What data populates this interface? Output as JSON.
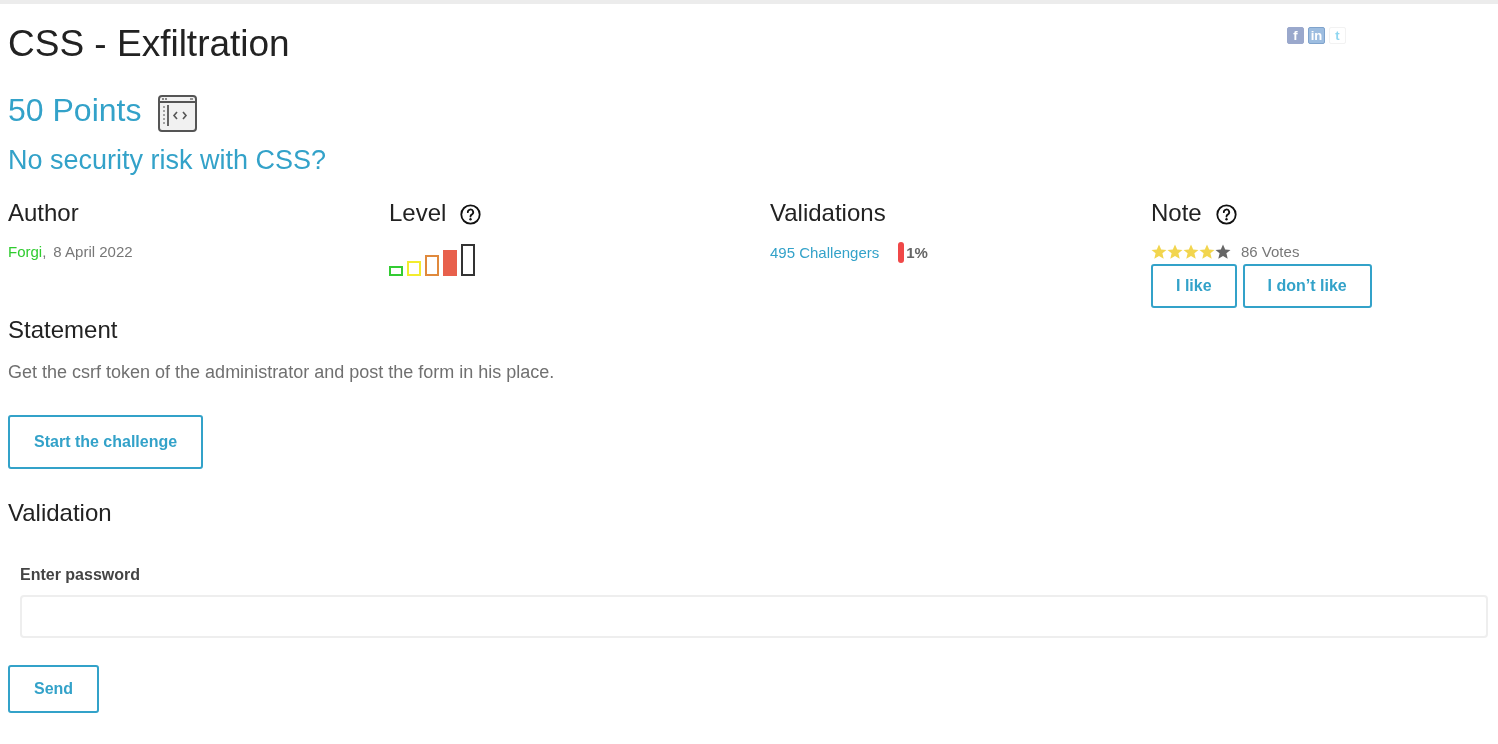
{
  "header": {
    "title": "CSS - Exfiltration",
    "points": "50 Points",
    "subtitle": "No security risk with CSS?"
  },
  "share_links": [
    {
      "kind": "facebook",
      "glyph": "f"
    },
    {
      "kind": "linkedin",
      "glyph": "in"
    },
    {
      "kind": "twitter",
      "glyph": "t"
    }
  ],
  "info": {
    "author": {
      "heading": "Author",
      "name": "Forgi",
      "separator": ",",
      "date": "8 April 2022"
    },
    "level": {
      "heading": "Level",
      "bars": [
        {
          "color": "#33cc33",
          "selected": false
        },
        {
          "color": "#f2ec2e",
          "selected": false
        },
        {
          "color": "#e0893c",
          "selected": false
        },
        {
          "color": "#e8604c",
          "selected": true
        },
        {
          "color": "#333333",
          "selected": false
        }
      ]
    },
    "validations": {
      "heading": "Validations",
      "challengers": "495 Challengers",
      "percent": "1%"
    },
    "note": {
      "heading": "Note",
      "stars": 4,
      "votes": "86 Votes",
      "buttons": [
        "I like",
        "I don’t like"
      ]
    }
  },
  "statement": {
    "heading": "Statement",
    "text": "Get the csrf token of the administrator and post the form in his place.",
    "button": "Start the challenge"
  },
  "validation": {
    "heading": "Validation",
    "label": "Enter password",
    "button": "Send"
  }
}
